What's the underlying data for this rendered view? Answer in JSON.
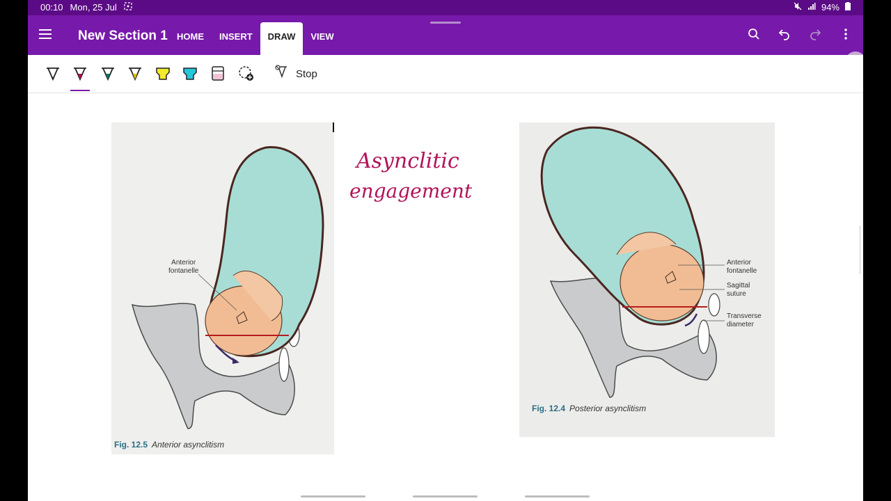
{
  "status": {
    "time": "00:10",
    "date": "Mon, 25 Jul",
    "battery": "94%"
  },
  "app": {
    "section_title": "New Section 1"
  },
  "tabs": [
    {
      "label": "HOME"
    },
    {
      "label": "INSERT"
    },
    {
      "label": "DRAW",
      "active": true
    },
    {
      "label": "VIEW"
    }
  ],
  "icons": {
    "menu": "hamburger-icon",
    "search": "search-icon",
    "undo": "undo-icon",
    "redo": "redo-icon",
    "more": "more-vert-icon",
    "edit": "pencil-icon"
  },
  "pens": [
    {
      "name": "black-pen",
      "color": "#222222"
    },
    {
      "name": "magenta-pen",
      "color": "#b2135a",
      "selected": true
    },
    {
      "name": "teal-pen",
      "color": "#0f7a6a"
    },
    {
      "name": "yellow-pen",
      "color": "#e0c400"
    },
    {
      "name": "yellow-highlighter",
      "color": "#f3ea29"
    },
    {
      "name": "cyan-highlighter",
      "color": "#25c8d8"
    },
    {
      "name": "pink-highlighter",
      "color": "#f2c3d6"
    }
  ],
  "toolbar": {
    "stop_label": "Stop"
  },
  "figure_left": {
    "caption_num": "Fig. 12.5",
    "caption_text": "Anterior asynclitism",
    "label_1": "Anterior",
    "label_2": "fontanelle"
  },
  "figure_right": {
    "caption_num": "Fig. 12.4",
    "caption_text": "Posterior asynclitism",
    "labels": [
      "Anterior",
      "fontanelle",
      "Sagittal",
      "suture",
      "Transverse",
      "diameter"
    ]
  },
  "handwriting": {
    "line_1": "Asynclitic",
    "line_2": "engagement"
  },
  "colors": {
    "brand": "#7719aa",
    "status": "#5c0b86",
    "ink": "#b2135a"
  }
}
